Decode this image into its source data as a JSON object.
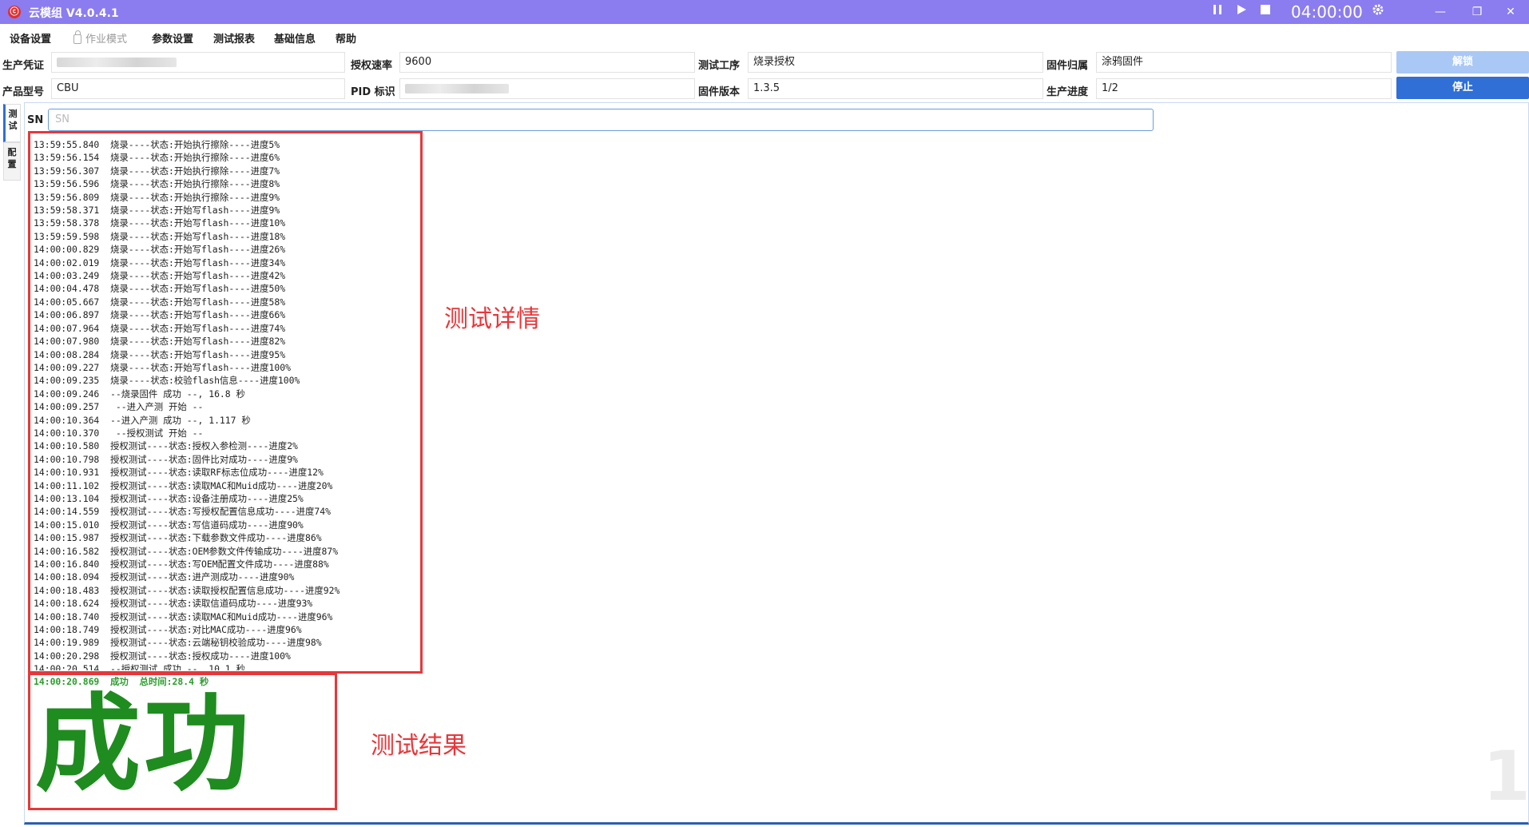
{
  "titlebar": {
    "title": "云模组 V4.0.4.1",
    "timer": "04:00:00",
    "pause_icon": "pause-icon",
    "play_icon": "play-icon",
    "stop_icon": "stop-icon",
    "settings_icon": "gear-icon",
    "minimize": "—",
    "restore": "❐",
    "close": "✕"
  },
  "menu": {
    "device_settings": "设备设置",
    "work_mode": "作业模式",
    "param_settings": "参数设置",
    "test_report": "测试报表",
    "base_info": "基础信息",
    "help": "帮助"
  },
  "form": {
    "production_credential_label": "生产凭证",
    "auth_rate_label": "授权速率",
    "auth_rate_value": "9600",
    "test_process_label": "测试工序",
    "test_process_value": "烧录授权",
    "firmware_owner_label": "固件归属",
    "firmware_owner_value": "涂鸦固件",
    "product_model_label": "产品型号",
    "product_model_value": "CBU",
    "pid_label": "PID 标识",
    "firmware_version_label": "固件版本",
    "firmware_version_value": "1.3.5",
    "progress_label": "生产进度",
    "progress_value": "1/2",
    "unlock_button": "解锁",
    "stop_button": "停止"
  },
  "sidetabs": {
    "test": "测\n试",
    "config": "配\n置"
  },
  "sn": {
    "label": "SN",
    "placeholder": "SN"
  },
  "log_lines": [
    "13:59:55.840  烧录----状态:开始执行擦除----进度5%",
    "13:59:56.154  烧录----状态:开始执行擦除----进度6%",
    "13:59:56.307  烧录----状态:开始执行擦除----进度7%",
    "13:59:56.596  烧录----状态:开始执行擦除----进度8%",
    "13:59:56.809  烧录----状态:开始执行擦除----进度9%",
    "13:59:58.371  烧录----状态:开始写flash----进度9%",
    "13:59:58.378  烧录----状态:开始写flash----进度10%",
    "13:59:59.598  烧录----状态:开始写flash----进度18%",
    "14:00:00.829  烧录----状态:开始写flash----进度26%",
    "14:00:02.019  烧录----状态:开始写flash----进度34%",
    "14:00:03.249  烧录----状态:开始写flash----进度42%",
    "14:00:04.478  烧录----状态:开始写flash----进度50%",
    "14:00:05.667  烧录----状态:开始写flash----进度58%",
    "14:00:06.897  烧录----状态:开始写flash----进度66%",
    "14:00:07.964  烧录----状态:开始写flash----进度74%",
    "14:00:07.980  烧录----状态:开始写flash----进度82%",
    "14:00:08.284  烧录----状态:开始写flash----进度95%",
    "14:00:09.227  烧录----状态:开始写flash----进度100%",
    "14:00:09.235  烧录----状态:校验flash信息----进度100%",
    "14:00:09.246  --烧录固件 成功 --, 16.8 秒",
    "14:00:09.257   --进入产测 开始 --",
    "14:00:10.364  --进入产测 成功 --, 1.117 秒",
    "14:00:10.370   --授权测试 开始 --",
    "14:00:10.580  授权测试----状态:授权入参检测----进度2%",
    "14:00:10.798  授权测试----状态:固件比对成功----进度9%",
    "14:00:10.931  授权测试----状态:读取RF标志位成功----进度12%",
    "14:00:11.102  授权测试----状态:读取MAC和Muid成功----进度20%",
    "14:00:13.104  授权测试----状态:设备注册成功----进度25%",
    "14:00:14.559  授权测试----状态:写授权配置信息成功----进度74%",
    "14:00:15.010  授权测试----状态:写信道码成功----进度90%",
    "14:00:15.987  授权测试----状态:下载参数文件成功----进度86%",
    "14:00:16.582  授权测试----状态:OEM参数文件传输成功----进度87%",
    "14:00:16.840  授权测试----状态:写OEM配置文件成功----进度88%",
    "14:00:18.094  授权测试----状态:进产测成功----进度90%",
    "14:00:18.483  授权测试----状态:读取授权配置信息成功----进度92%",
    "14:00:18.624  授权测试----状态:读取信道码成功----进度93%",
    "14:00:18.740  授权测试----状态:读取MAC和Muid成功----进度96%",
    "14:00:18.749  授权测试----状态:对比MAC成功----进度96%",
    "14:00:19.989  授权测试----状态:云端秘钥校验成功----进度98%",
    "14:00:20.298  授权测试----状态:授权成功----进度100%",
    "14:00:20.514  --授权测试 成功 --, 10.1 秒"
  ],
  "result": {
    "summary_line": "14:00:20.869  成功  总时间:28.4 秒",
    "big_text": "成功",
    "counter": "1"
  },
  "annotations": {
    "details": "测试详情",
    "result": "测试结果"
  },
  "colors": {
    "titlebar": "#8b7cf0",
    "primary_button": "#2f6fd6",
    "success": "#1f8c1f",
    "annotation": "#e8373a"
  }
}
